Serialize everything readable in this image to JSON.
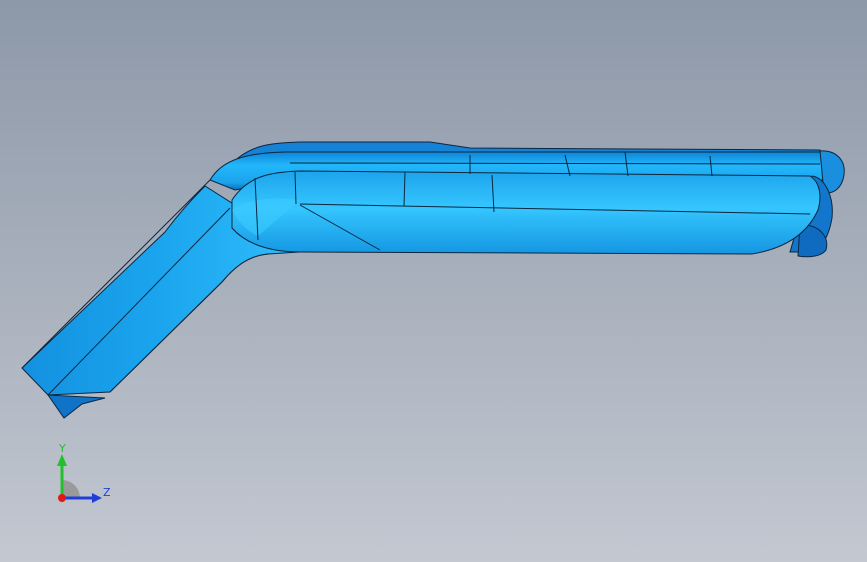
{
  "viewport": {
    "background_top": "#8d98a8",
    "background_bottom": "#c3c8d1"
  },
  "model": {
    "part_type": "bent-tube-bundle",
    "color_base": "#1aa6ee",
    "color_light": "#33c3ff",
    "color_dark": "#0b6dbd",
    "edge_color": "#0b2740"
  },
  "triad": {
    "y_label": "Y",
    "z_label": "Z",
    "y_color": "#22c02c",
    "z_color": "#1f3fd8",
    "x_color": "#e01818",
    "y_icon": "y-axis-arrow-icon",
    "z_icon": "z-axis-arrow-icon",
    "x_icon": "x-axis-origin-icon"
  }
}
